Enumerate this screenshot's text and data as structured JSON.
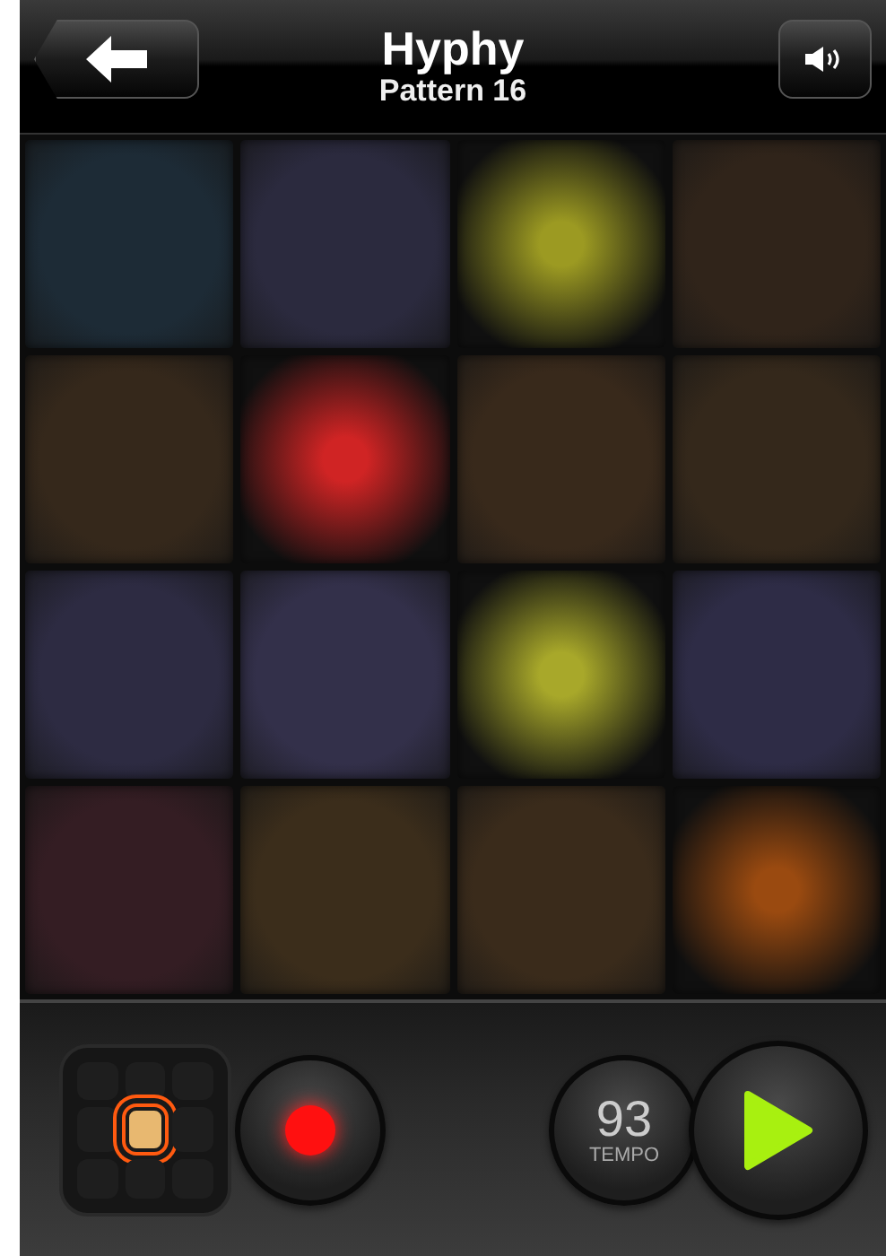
{
  "header": {
    "title": "Hyphy",
    "subtitle": "Pattern 16"
  },
  "pads": [
    {
      "color": "#1d2b36",
      "lit": false
    },
    {
      "color": "#2b2a3e",
      "lit": false
    },
    {
      "color": "#9c9a22",
      "lit": true
    },
    {
      "color": "#30241a",
      "lit": false
    },
    {
      "color": "#35281b",
      "lit": false
    },
    {
      "color": "#d02424",
      "lit": true
    },
    {
      "color": "#38291b",
      "lit": false
    },
    {
      "color": "#34281b",
      "lit": false
    },
    {
      "color": "#2d2b42",
      "lit": false
    },
    {
      "color": "#33304a",
      "lit": false
    },
    {
      "color": "#a8a82a",
      "lit": true
    },
    {
      "color": "#2e2c46",
      "lit": false
    },
    {
      "color": "#341d23",
      "lit": false
    },
    {
      "color": "#3b2d1b",
      "lit": false
    },
    {
      "color": "#3a2b1b",
      "lit": false
    },
    {
      "color": "#9a4a10",
      "lit": true
    }
  ],
  "bank": {
    "cells": [
      {
        "selected": false
      },
      {
        "selected": false
      },
      {
        "selected": false
      },
      {
        "selected": false
      },
      {
        "selected": true
      },
      {
        "selected": false
      },
      {
        "selected": false
      },
      {
        "selected": false
      },
      {
        "selected": false
      }
    ]
  },
  "record": {
    "on": true
  },
  "tempo": {
    "value": "93",
    "label": "TEMPO"
  }
}
